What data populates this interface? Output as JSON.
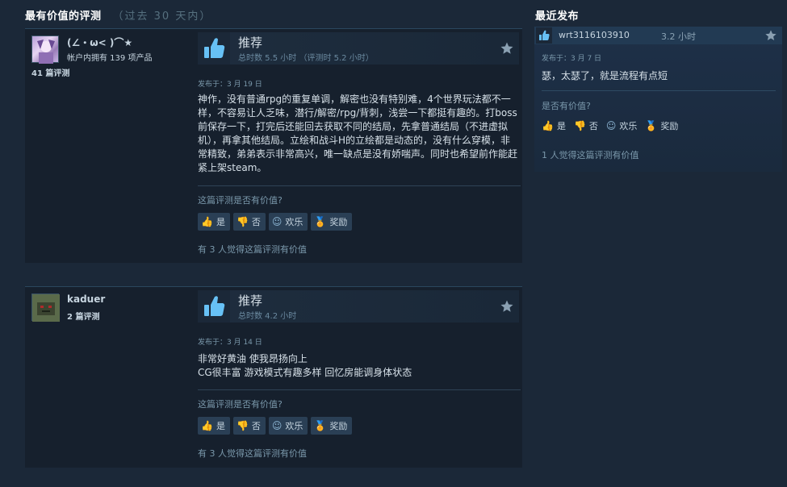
{
  "most_helpful": {
    "title": "最有价值的评测",
    "subtitle": "（过去 30 天内）"
  },
  "recent": {
    "title": "最近发布",
    "review": {
      "author": "wrt3116103910",
      "hours": "3.2 小时",
      "posted": "发布于：3 月 7 日",
      "text": "瑟，太瑟了，就是流程有点短",
      "helpful_question": "是否有价值?",
      "buttons": {
        "yes": "是",
        "no": "否",
        "funny": "欢乐",
        "award": "奖励"
      },
      "helpful_count": "1 人觉得这篇评测有价值"
    }
  },
  "reviews": [
    {
      "author": "(∠・ω< )⌒★",
      "meta_products": "帐户内拥有 139 项产品",
      "meta_reviews": "41 篇评测",
      "verdict": "推荐",
      "hours": "总时数 5.5 小时  （评测时 5.2 小时）",
      "posted": "发布于：3 月 19 日",
      "text": "神作，没有普通rpg的重复单调，解密也没有特别难，4个世界玩法都不一样，不容易让人乏味，潜行/解密/rpg/背刺，浅尝一下都挺有趣的。打boss前保存一下，打完后还能回去获取不同的结局，先拿普通结局（不进虚拟机），再拿其他结局。立绘和战斗H的立绘都是动态的，没有什么穿模，非常精致，弟弟表示非常高兴，唯一缺点是没有娇喘声。同时也希望前作能赶紧上架steam。",
      "helpful_question": "这篇评测是否有价值?",
      "buttons": {
        "yes": "是",
        "no": "否",
        "funny": "欢乐",
        "award": "奖励"
      },
      "helpful_count": "有 3 人觉得这篇评测有价值"
    },
    {
      "author": "kaduer",
      "meta_reviews": "2 篇评测",
      "verdict": "推荐",
      "hours": "总时数 4.2 小时",
      "posted": "发布于：3 月 14 日",
      "text_line1": "非常好黄油 使我昂扬向上",
      "text_line2": "CG很丰富 游戏模式有趣多样 回忆房能调身体状态",
      "helpful_question": "这篇评测是否有价值?",
      "buttons": {
        "yes": "是",
        "no": "否",
        "funny": "欢乐",
        "award": "奖励"
      },
      "helpful_count": "有 3 人觉得这篇评测有价值"
    }
  ],
  "colors": {
    "background": "#1b2838",
    "card": "#16202d",
    "accent_blue": "#67c1f5",
    "award_gold": "#e2c23a"
  },
  "icons": {
    "recommend": "thumbs-up-icon",
    "star": "star-icon",
    "yes": "thumbs-up-small-icon",
    "no": "thumbs-down-small-icon",
    "funny": "smiley-icon",
    "award": "award-ribbon-icon"
  }
}
